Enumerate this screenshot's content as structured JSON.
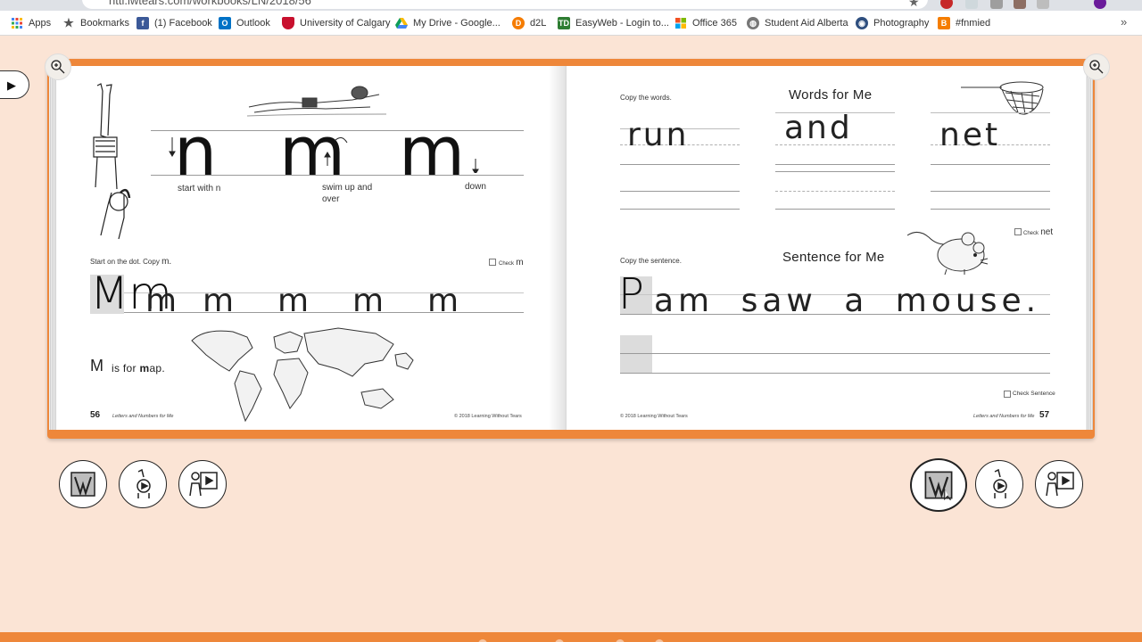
{
  "browser": {
    "url": "nttl.lwtears.com/workbooks/LN/2018/56",
    "bookmarks": [
      {
        "label": "Apps",
        "icon": "apps-grid-icon",
        "color": "#4285f4"
      },
      {
        "label": "Bookmarks",
        "icon": "star-icon",
        "color": "#555555"
      },
      {
        "label": "(1) Facebook",
        "icon": "facebook-icon",
        "color": "#3b5998"
      },
      {
        "label": "Outlook",
        "icon": "outlook-icon",
        "color": "#0072c6"
      },
      {
        "label": "University of Calgary",
        "icon": "university-crest-icon",
        "color": "#c8102e"
      },
      {
        "label": "My Drive - Google...",
        "icon": "google-drive-icon",
        "color": "#0f9d58"
      },
      {
        "label": "d2L",
        "icon": "d2l-icon",
        "color": "#f57c00"
      },
      {
        "label": "EasyWeb - Login to...",
        "icon": "td-bank-icon",
        "color": "#2e7d32"
      },
      {
        "label": "Office 365",
        "icon": "office-icon",
        "color": "#f25022"
      },
      {
        "label": "Student Aid Alberta",
        "icon": "globe-icon",
        "color": "#777777"
      },
      {
        "label": "Photography",
        "icon": "camera-icon",
        "color": "#2f4f7f"
      },
      {
        "label": "#fnmied",
        "icon": "blogger-icon",
        "color": "#f57d00"
      }
    ]
  },
  "colors": {
    "background": "#fbe4d5",
    "book_frame": "#ee873a",
    "text": "#222222"
  },
  "left_page": {
    "letters": [
      "n",
      "m",
      "m"
    ],
    "captions": [
      "start with n",
      "swim up and over",
      "down"
    ],
    "instruction": "Start on the dot. Copy",
    "instruction_letter": "m.",
    "check_label": "Check",
    "check_letter": "m",
    "model_letters": "Mm",
    "practice_letters": [
      "m",
      "m",
      "m",
      "m",
      "m"
    ],
    "word_letter": "M",
    "word_phrase_1": "is for",
    "word_bold": "m",
    "word_rest": "ap.",
    "page_number": "56",
    "footer_title": "Letters and Numbers for Me",
    "copyright": "© 2018 Learning Without Tears"
  },
  "right_page": {
    "instruction_words": "Copy the words.",
    "title_words": "Words for Me",
    "words": [
      "run",
      "and",
      "net"
    ],
    "check_label": "Check",
    "check_word": "net",
    "instruction_sentence": "Copy the sentence.",
    "title_sentence": "Sentence for Me",
    "sentence_first": "P",
    "sentence_rest": "am saw a mouse.",
    "check_sentence": "Check Sentence",
    "copyright": "© 2018 Learning Without Tears",
    "footer_title": "Letters and Numbers for Me",
    "page_number": "57"
  },
  "toolbars": {
    "left": [
      "letter-demo-button",
      "video-button",
      "teacher-video-button"
    ],
    "right": [
      "letter-demo-button",
      "video-button",
      "teacher-video-button"
    ],
    "active_right": "letter-demo-button"
  }
}
